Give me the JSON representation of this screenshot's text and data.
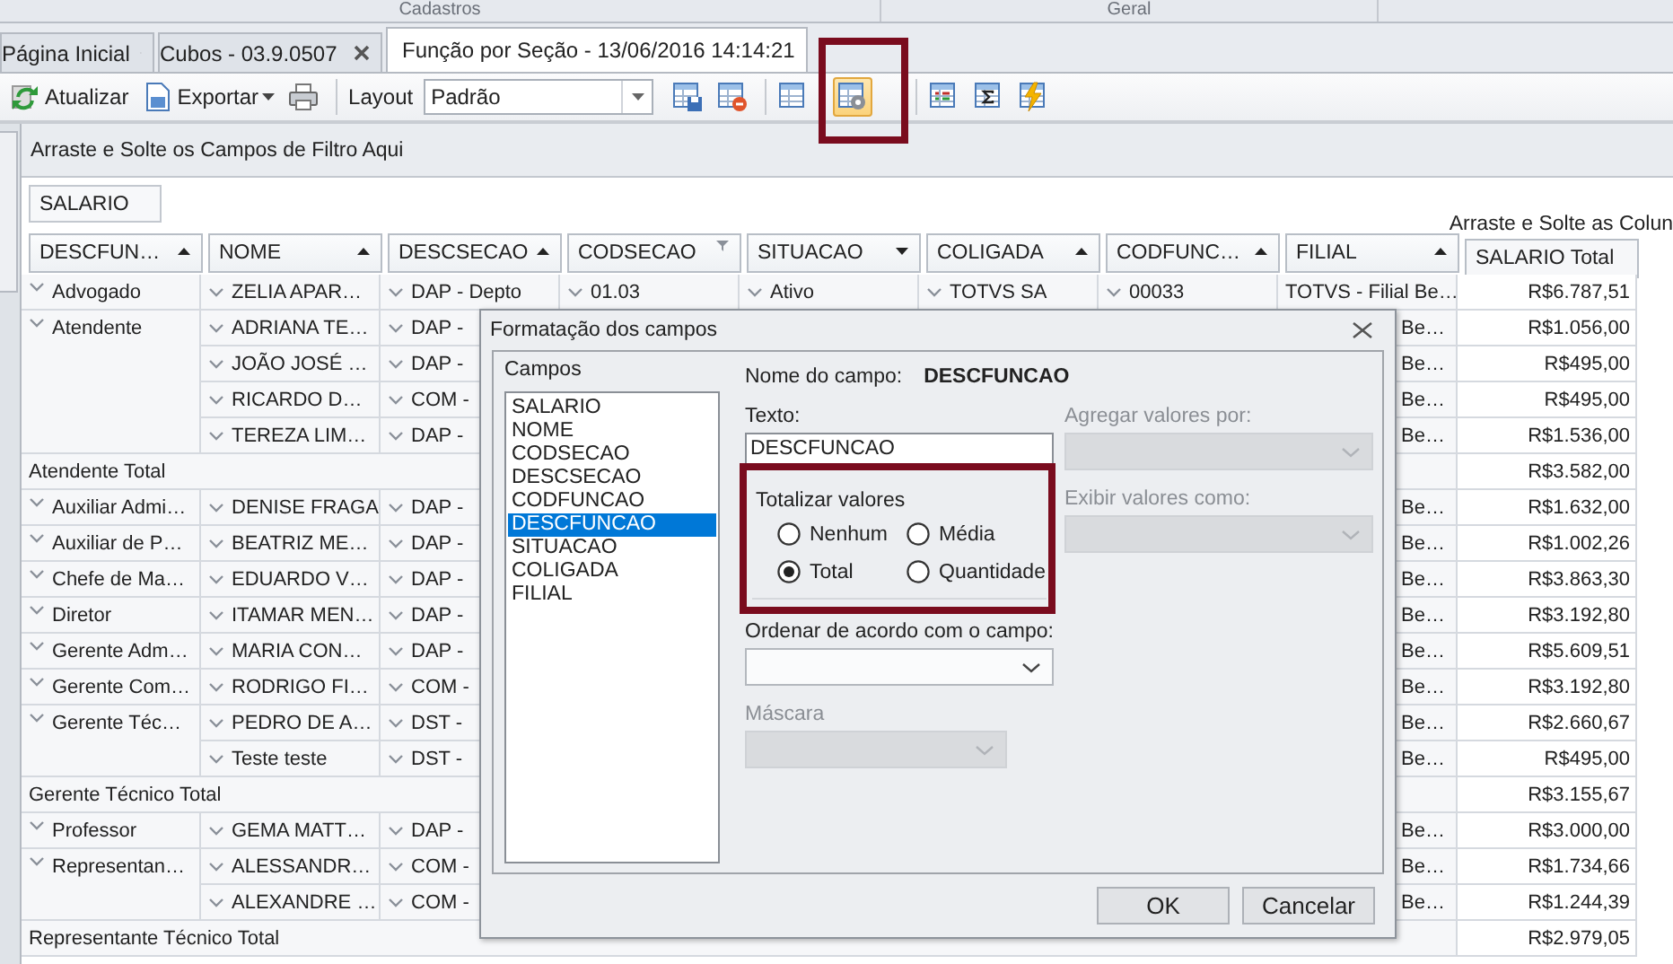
{
  "ribbon_groups": [
    {
      "label": "Cadastros"
    },
    {
      "label": "Geral"
    }
  ],
  "tabs": [
    {
      "label": "Página Inicial",
      "selected": false
    },
    {
      "label": "Cubos - 03.9.0507",
      "selected": false
    },
    {
      "label": "Função por Seção - 13/06/2016 14:14:21",
      "selected": true
    }
  ],
  "toolbar": {
    "items": [
      {
        "kind": "refresh",
        "label": "Atualizar"
      },
      {
        "kind": "export",
        "label": "Exportar"
      },
      {
        "kind": "print",
        "selected": false
      },
      {
        "kind": "separator"
      },
      {
        "kind": "combo",
        "label": "Layout",
        "value": "Padrão"
      },
      {
        "kind": "save",
        "selected": false
      },
      {
        "kind": "delete",
        "selected": false
      },
      {
        "kind": "separator"
      },
      {
        "kind": "table",
        "selected": false
      },
      {
        "kind": "settings",
        "selected": true
      },
      {
        "kind": "separator"
      },
      {
        "kind": "columns",
        "selected": false
      },
      {
        "kind": "sigma",
        "selected": false
      },
      {
        "kind": "lightning",
        "selected": false
      }
    ]
  },
  "filter_area": {
    "hint": "Arraste e Solte os Campos de Filtro Aqui"
  },
  "data_fields": [
    {
      "label": "SALARIO"
    }
  ],
  "column_area": {
    "hint": "Arraste e Solte as Colun"
  },
  "columns": [
    {
      "label": "DESCFUN…",
      "kind": "sorted",
      "descending": false
    },
    {
      "label": "NOME",
      "kind": "sorted",
      "descending": false
    },
    {
      "label": "DESCSECAO",
      "kind": "sorted",
      "descending": false
    },
    {
      "label": "CODSECAO",
      "kind": "filtered"
    },
    {
      "label": "SITUACAO",
      "kind": "sorted",
      "descending": true
    },
    {
      "label": "COLIGADA",
      "kind": "sorted",
      "descending": false
    },
    {
      "label": "CODFUNC…",
      "kind": "sorted",
      "descending": false
    },
    {
      "label": "FILIAL",
      "kind": "sorted",
      "descending": false
    },
    {
      "label": "SALARIO Total",
      "kind": "total"
    }
  ],
  "groups": [
    {
      "label": "Advogado",
      "members": [
        {
          "nome": "ZELIA APAR…",
          "descsecao": "DAP - Depto",
          "codsecao": "01.03",
          "situacao": "Ativo",
          "coligada": "TOTVS SA",
          "codfuncao": "00033",
          "filial": "TOTVS - Filial Be…",
          "salario": "R$6.787,51"
        }
      ]
    },
    {
      "label": "Atendente",
      "members": [
        {
          "nome": "ADRIANA TE…",
          "descsecao": "DAP -",
          "filial": "Be…",
          "salario": "R$1.056,00"
        },
        {
          "nome": "JOÃO JOSÉ …",
          "descsecao": "DAP -",
          "filial": "Be…",
          "salario": "R$495,00"
        },
        {
          "nome": "RICARDO D…",
          "descsecao": "COM -",
          "filial": "Be…",
          "salario": "R$495,00"
        },
        {
          "nome": "TEREZA LIM…",
          "descsecao": "DAP -",
          "filial": "Be…",
          "salario": "R$1.536,00"
        }
      ],
      "total": {
        "label": "Atendente Total",
        "value": "R$3.582,00"
      }
    },
    {
      "label": "Auxiliar Admi…",
      "members": [
        {
          "nome": "DENISE FRAGA",
          "descsecao": "DAP -",
          "filial": "Be…",
          "salario": "R$1.632,00"
        }
      ]
    },
    {
      "label": "Auxiliar de P…",
      "members": [
        {
          "nome": "BEATRIZ ME…",
          "descsecao": "DAP -",
          "filial": "Be…",
          "salario": "R$1.002,26"
        }
      ]
    },
    {
      "label": "Chefe de Ma…",
      "members": [
        {
          "nome": "EDUARDO V…",
          "descsecao": "DAP -",
          "filial": "Be…",
          "salario": "R$3.863,30"
        }
      ]
    },
    {
      "label": "Diretor",
      "members": [
        {
          "nome": "ITAMAR MEN…",
          "descsecao": "DAP -",
          "filial": "Be…",
          "salario": "R$3.192,80"
        }
      ]
    },
    {
      "label": "Gerente Adm…",
      "members": [
        {
          "nome": "MARIA CON…",
          "descsecao": "DAP -",
          "filial": "Be…",
          "salario": "R$5.609,51"
        }
      ]
    },
    {
      "label": "Gerente Com…",
      "members": [
        {
          "nome": "RODRIGO FI…",
          "descsecao": "COM -",
          "filial": "Be…",
          "salario": "R$3.192,80"
        }
      ]
    },
    {
      "label": "Gerente Téc…",
      "members": [
        {
          "nome": "PEDRO DE A…",
          "descsecao": "DST -",
          "filial": "Be…",
          "salario": "R$2.660,67"
        },
        {
          "nome": "Teste teste",
          "descsecao": "DST -",
          "filial": "Be…",
          "salario": "R$495,00"
        }
      ],
      "total": {
        "label": "Gerente Técnico Total",
        "value": "R$3.155,67"
      }
    },
    {
      "label": "Professor",
      "members": [
        {
          "nome": "GEMA MATT…",
          "descsecao": "DAP -",
          "filial": "Be…",
          "salario": "R$3.000,00"
        }
      ]
    },
    {
      "label": "Representan…",
      "members": [
        {
          "nome": "ALESSANDR…",
          "descsecao": "COM -",
          "filial": "Be…",
          "salario": "R$1.734,66"
        },
        {
          "nome": "ALEXANDRE …",
          "descsecao": "COM -",
          "filial": "Be…",
          "salario": "R$1.244,39"
        }
      ],
      "total": {
        "label": "Representante Técnico Total",
        "value": "R$2.979,05"
      }
    }
  ],
  "dialog": {
    "title": "Formatação dos campos",
    "fields_label": "Campos",
    "fields": [
      {
        "label": "SALARIO",
        "selected": false
      },
      {
        "label": "NOME",
        "selected": false
      },
      {
        "label": "CODSECAO",
        "selected": false
      },
      {
        "label": "DESCSECAO",
        "selected": false
      },
      {
        "label": "CODFUNCAO",
        "selected": false
      },
      {
        "label": "DESCFUNCAO",
        "selected": true
      },
      {
        "label": "SITUACAO",
        "selected": false
      },
      {
        "label": "COLIGADA",
        "selected": false
      },
      {
        "label": "FILIAL",
        "selected": false
      }
    ],
    "field_name_label": "Nome do campo:",
    "field_name": "DESCFUNCAO",
    "text_label": "Texto:",
    "text_value": "DESCFUNCAO",
    "totals": {
      "label": "Totalizar valores",
      "options": [
        {
          "label": "Nenhum",
          "selected": false
        },
        {
          "label": "Média",
          "selected": false
        },
        {
          "label": "Total",
          "selected": true
        },
        {
          "label": "Quantidade",
          "selected": false
        }
      ]
    },
    "combos": [
      {
        "label": "Agregar valores por:",
        "disabled": true
      },
      {
        "label": "Exibir valores como:",
        "disabled": true
      },
      {
        "label": "Ordenar de acordo com o campo:",
        "disabled": false
      },
      {
        "label": "Máscara",
        "disabled": true
      }
    ],
    "buttons": [
      {
        "label": "OK"
      },
      {
        "label": "Cancelar"
      }
    ]
  }
}
